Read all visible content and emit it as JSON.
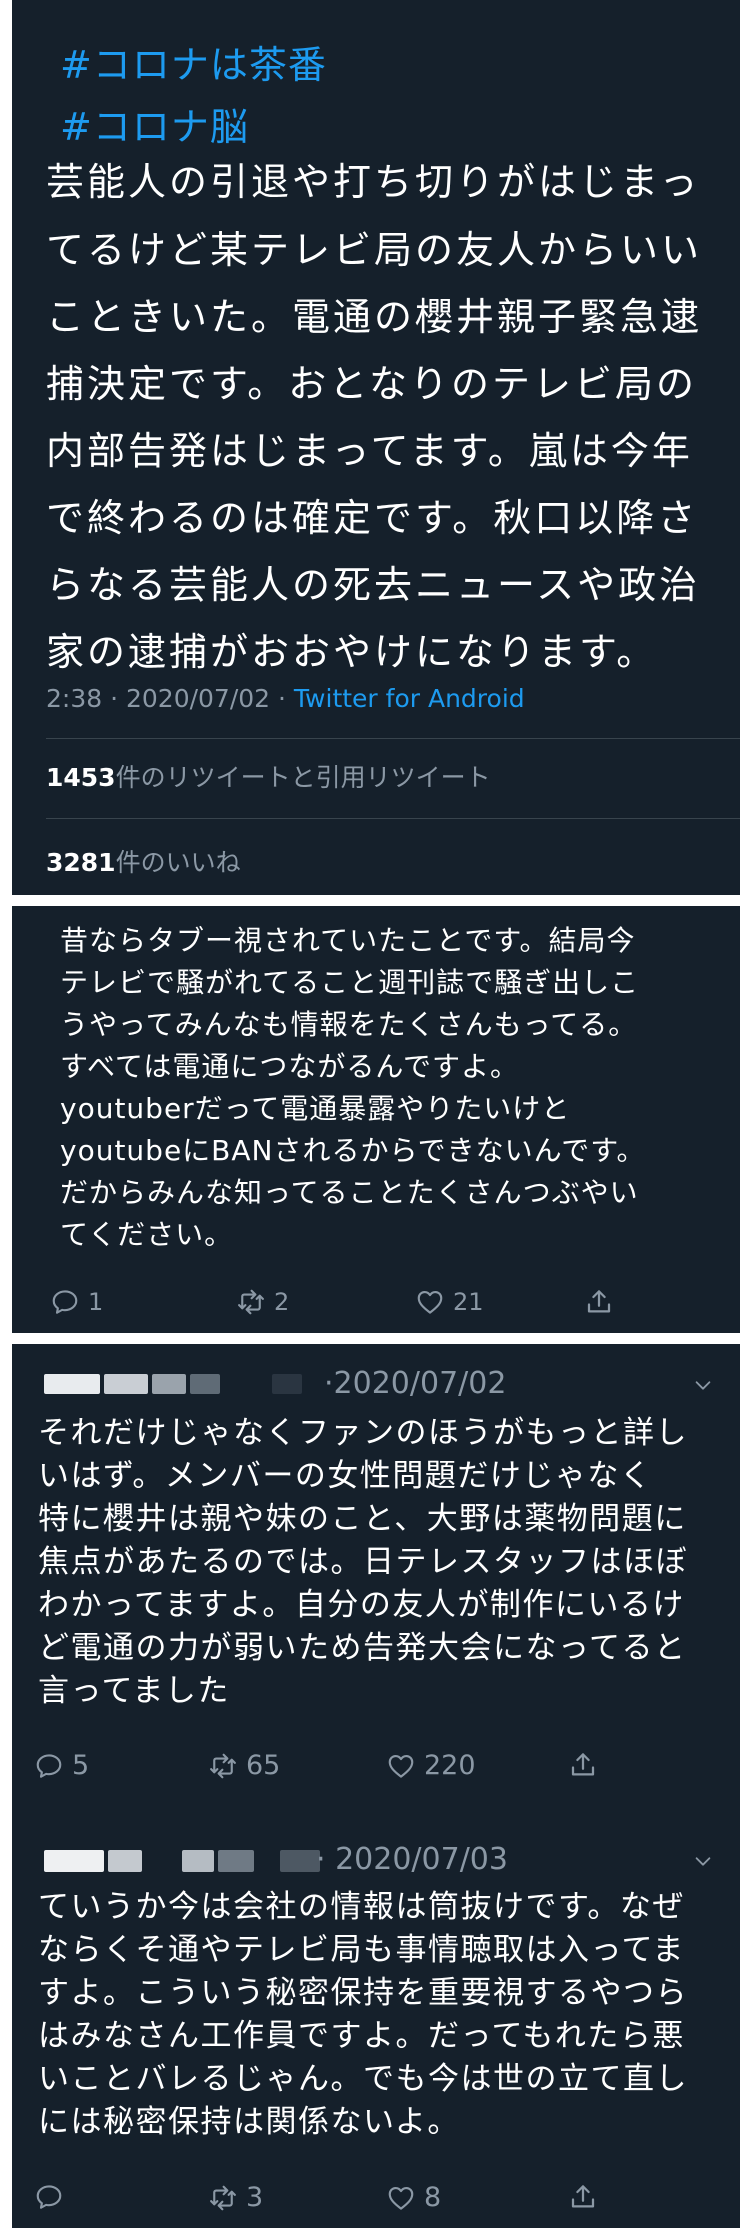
{
  "tweet": {
    "hashtags": [
      "#コロナは茶番",
      "#コロナ脳"
    ],
    "lines": [
      "芸能人の引退や打ち切りがはじまっ",
      "てるけど某テレビ局の友人からいい",
      "こときいた。電通の櫻井親子緊急逮",
      "捕決定です。おとなりのテレビ局の",
      "内部告発はじまってます。嵐は今年",
      "で終わるのは確定です。秋口以降さ",
      "らなる芸能人の死去ニュースや政治",
      "家の逮捕がおおやけになります。"
    ],
    "time": "2:38 · 2020/07/02 · ",
    "via": "Twitter for Android",
    "retweet_count": "1453",
    "retweet_label": "件のリツイートと引用リツイート",
    "like_count": "3281",
    "like_label": "件のいいね"
  },
  "reply1": {
    "lines": [
      "昔ならタブー視されていたことです。結局今",
      "テレビで騒がれてること週刊誌で騒ぎ出しこ",
      "うやってみんなも情報をたくさんもってる。",
      "すべては電通につながるんですよ。",
      "youtuberだって電通暴露やりたいけと",
      "youtubeにBANされるからできないんです。",
      "だからみんな知ってることたくさんつぶやい",
      "てください。"
    ],
    "replies": "1",
    "retweets": "2",
    "likes": "21"
  },
  "reply2": {
    "date": "·2020/07/02",
    "lines": [
      "それだけじゃなくファンのほうがもっと詳し",
      "いはず。メンバーの女性問題だけじゃなく",
      "特に櫻井は親や妹のこと、大野は薬物問題に",
      "焦点があたるのでは。日テレスタッフはほぼ",
      "わかってますよ。自分の友人が制作にいるけ",
      "ど電通の力が弱いため告発大会になってると",
      "言ってました"
    ],
    "replies": "5",
    "retweets": "65",
    "likes": "220"
  },
  "reply3": {
    "date": "· 2020/07/03",
    "lines": [
      "ていうか今は会社の情報は筒抜けです。なぜ",
      "ならくそ通やテレビ局も事情聴取は入ってま",
      "すよ。こういう秘密保持を重要視するやつら",
      "はみなさん工作員ですよ。だってもれたら悪",
      "いことバレるじゃん。でも今は世の立て直し",
      "には秘密保持は関係ないよ。"
    ],
    "replies": "",
    "retweets": "3",
    "likes": "8"
  },
  "colors": {
    "background": "#15202b",
    "text": "#ffffff",
    "muted": "#8b98a5",
    "link": "#1d9bf0"
  },
  "icons": [
    "reply-icon",
    "retweet-icon",
    "like-icon",
    "share-icon",
    "chevron-down-icon"
  ]
}
